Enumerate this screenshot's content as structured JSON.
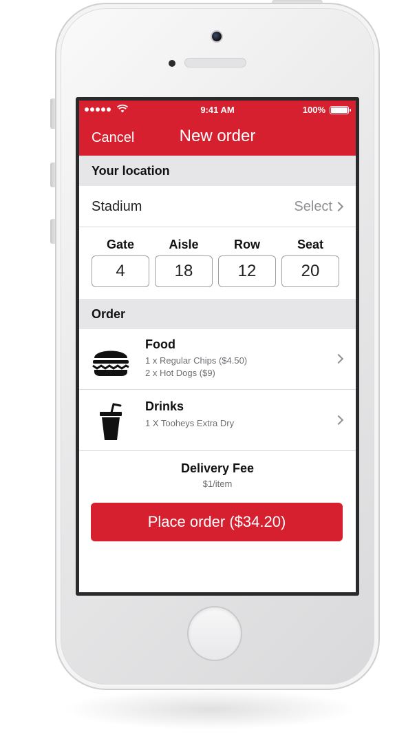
{
  "status_bar": {
    "time": "9:41 AM",
    "battery_percent": "100%"
  },
  "navbar": {
    "cancel_label": "Cancel",
    "title": "New order"
  },
  "location_section": {
    "header": "Your location",
    "stadium_label": "Stadium",
    "stadium_value": "Select"
  },
  "seat": {
    "fields": [
      {
        "label": "Gate",
        "value": "4"
      },
      {
        "label": "Aisle",
        "value": "18"
      },
      {
        "label": "Row",
        "value": "12"
      },
      {
        "label": "Seat",
        "value": "20"
      }
    ]
  },
  "order_section": {
    "header": "Order",
    "items": [
      {
        "title": "Food",
        "icon": "burger-icon",
        "lines": [
          "1 x Regular Chips ($4.50)",
          "2 x Hot Dogs ($9)"
        ]
      },
      {
        "title": "Drinks",
        "icon": "drink-cup-icon",
        "lines": [
          "1 X Tooheys Extra Dry"
        ]
      }
    ]
  },
  "delivery": {
    "title": "Delivery Fee",
    "subtitle": "$1/item"
  },
  "place_order_label": "Place order ($34.20)",
  "colors": {
    "brand_red": "#d6202f",
    "section_header_bg": "#e6e6e8",
    "secondary_text": "#8e8e93"
  }
}
